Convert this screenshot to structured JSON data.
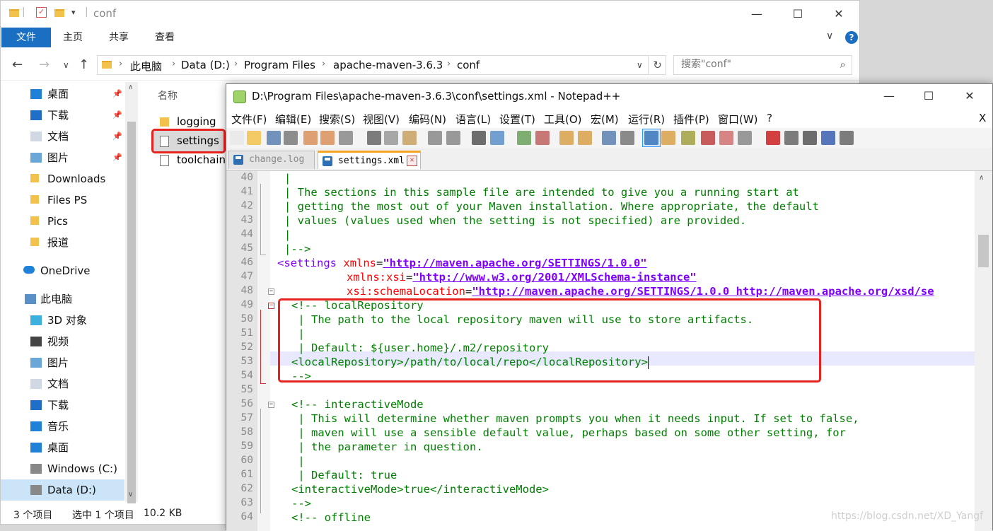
{
  "explorer": {
    "title": "conf",
    "ribbon_tabs": [
      "文件",
      "主页",
      "共享",
      "查看"
    ],
    "breadcrumb": [
      "此电脑",
      "Data (D:)",
      "Program Files",
      "apache-maven-3.6.3",
      "conf"
    ],
    "search_placeholder": "搜索\"conf\"",
    "column_header": "名称",
    "nav_items": [
      {
        "label": "桌面",
        "icon": "desktop-icon",
        "pinned": true
      },
      {
        "label": "下载",
        "icon": "download-icon",
        "pinned": true
      },
      {
        "label": "文档",
        "icon": "document-icon",
        "pinned": true
      },
      {
        "label": "图片",
        "icon": "picture-icon",
        "pinned": true
      },
      {
        "label": "Downloads",
        "icon": "folder-icon",
        "pinned": false
      },
      {
        "label": "Files PS",
        "icon": "folder-icon",
        "pinned": false
      },
      {
        "label": "Pics",
        "icon": "folder-icon",
        "pinned": false
      },
      {
        "label": "报道",
        "icon": "folder-icon",
        "pinned": false
      },
      {
        "label": "OneDrive",
        "icon": "cloud-icon",
        "pinned": false
      },
      {
        "label": "此电脑",
        "icon": "computer-icon",
        "pinned": false
      },
      {
        "label": "3D 对象",
        "icon": "3d-object-icon",
        "pinned": false
      },
      {
        "label": "视频",
        "icon": "video-icon",
        "pinned": false
      },
      {
        "label": "图片",
        "icon": "picture-icon",
        "pinned": false
      },
      {
        "label": "文档",
        "icon": "document-icon",
        "pinned": false
      },
      {
        "label": "下载",
        "icon": "download-icon",
        "pinned": false
      },
      {
        "label": "音乐",
        "icon": "music-icon",
        "pinned": false
      },
      {
        "label": "桌面",
        "icon": "desktop-icon",
        "pinned": false
      },
      {
        "label": "Windows (C:)",
        "icon": "drive-icon",
        "pinned": false
      },
      {
        "label": "Data (D:)",
        "icon": "drive-icon",
        "pinned": false
      }
    ],
    "files": [
      {
        "name": "logging",
        "type": "folder"
      },
      {
        "name": "settings",
        "type": "file"
      },
      {
        "name": "toolchains",
        "type": "file"
      }
    ],
    "status": {
      "count": "3 个项目",
      "selected": "选中 1 个项目",
      "size": "10.2 KB"
    }
  },
  "notepad": {
    "title": "D:\\Program Files\\apache-maven-3.6.3\\conf\\settings.xml - Notepad++",
    "menus": [
      "文件(F)",
      "编辑(E)",
      "搜索(S)",
      "视图(V)",
      "编码(N)",
      "语言(L)",
      "设置(T)",
      "工具(O)",
      "宏(M)",
      "运行(R)",
      "插件(P)",
      "窗口(W)",
      "?"
    ],
    "menu_close": "X",
    "tabs": [
      {
        "label": "change.log",
        "active": false
      },
      {
        "label": "settings.xml",
        "active": true
      }
    ],
    "line_numbers": [
      "40",
      "41",
      "42",
      "43",
      "44",
      "45",
      "46",
      "47",
      "48",
      "49",
      "50",
      "51",
      "52",
      "53",
      "54",
      "55",
      "56",
      "57",
      "58",
      "59",
      "60",
      "61",
      "62",
      "63",
      "64"
    ],
    "code": {
      "l40": "|",
      "l41": "| The sections in this sample file are intended to give you a running start at",
      "l42": "| getting the most out of your Maven installation. Where appropriate, the default",
      "l43": "| values (values used when the setting is not specified) are provided.",
      "l44": "|",
      "l45": "|-->",
      "l46_tag": "<settings ",
      "l46_attr": "xmlns",
      "l46_eq": "=",
      "l46_val": "\"http://maven.apache.org/SETTINGS/1.0.0\"",
      "l47_attr": "xmlns:xsi",
      "l47_eq": "=",
      "l47_val": "\"http://www.w3.org/2001/XMLSchema-instance\"",
      "l48_attr": "xsi:schemaLocation",
      "l48_eq": "=",
      "l48_val": "\"http://maven.apache.org/SETTINGS/1.0.0 http://maven.apache.org/xsd/se",
      "l49": "<!-- localRepository",
      "l50": " | The path to the local repository maven will use to store artifacts.",
      "l51": " |",
      "l52": " | Default: ${user.home}/.m2/repository",
      "l53_open": "<localRepository>",
      "l53_text": "/path/to/local/repo",
      "l53_close": "</localRepository>",
      "l54": "-->",
      "l55": "",
      "l56": "<!-- interactiveMode",
      "l57": " | This will determine whether maven prompts you when it needs input. If set to false,",
      "l58": " | maven will use a sensible default value, perhaps based on some other setting, for",
      "l59": " | the parameter in question.",
      "l60": " |",
      "l61": " | Default: true",
      "l62_open": "<interactiveMode>",
      "l62_text": "true",
      "l62_close": "</interactiveMode>",
      "l63": "-->",
      "l64": "<!-- offline"
    }
  },
  "watermark": "https://blog.csdn.net/XD_Yangf",
  "colors": {
    "accent": "#1a6fc2",
    "highlight": "#e8231f",
    "comment": "#008000",
    "tag": "#8000ff",
    "attribute": "#ff0000"
  }
}
